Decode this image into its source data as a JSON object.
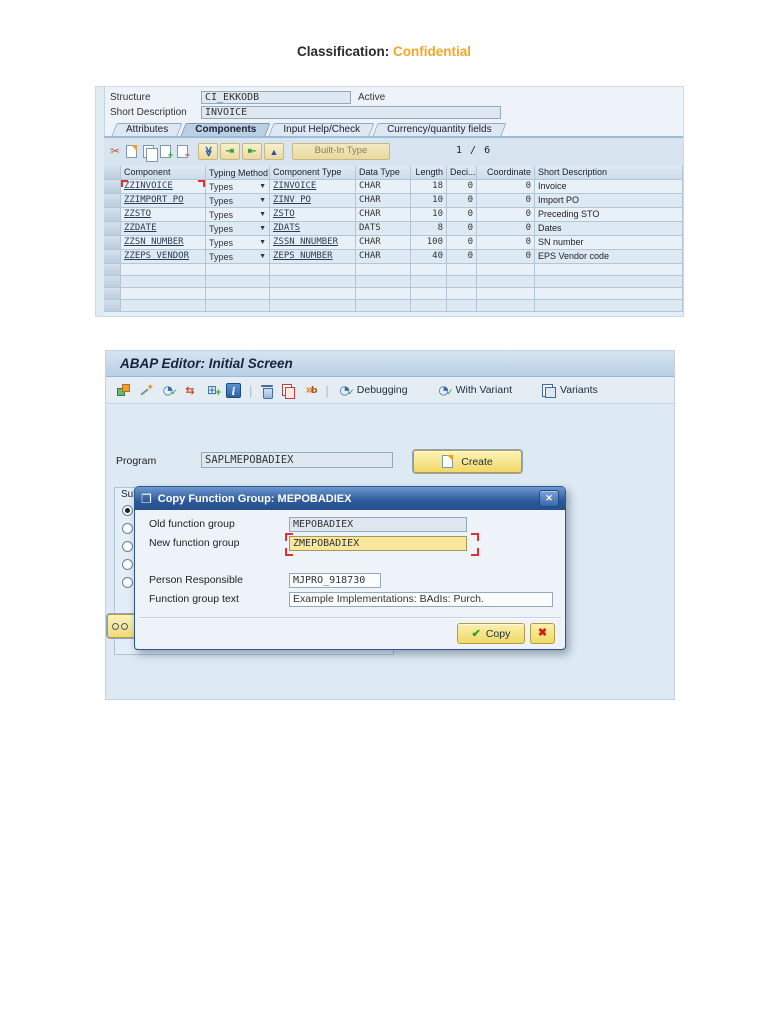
{
  "page": {
    "classification_label": "Classification:",
    "classification_value": "Confidential",
    "accent_orange": "#f5a623"
  },
  "structure_editor": {
    "structure_label": "Structure",
    "structure_value": "CI_EKKODB",
    "status": "Active",
    "short_description_label": "Short Description",
    "short_description_value": "INVOICE",
    "tabs": [
      "Attributes",
      "Components",
      "Input Help/Check",
      "Currency/quantity fields"
    ],
    "active_tab": "Components",
    "toolbar": {
      "builtin_type_label": "Built-In Type",
      "position_indicator": "1 / 6"
    },
    "table": {
      "headers": [
        "Component",
        "Typing Method",
        "Component Type",
        "Data Type",
        "Length",
        "Deci...",
        "Coordinate",
        "Short Description"
      ],
      "rows": [
        {
          "component": "ZZINVOICE",
          "typing_method": "Types",
          "component_type": "ZINVOICE",
          "data_type": "CHAR",
          "length": "18",
          "decimals": "0",
          "coordinate": "0",
          "short_description": "Invoice"
        },
        {
          "component": "ZZIMPORT_PO",
          "typing_method": "Types",
          "component_type": "ZINV_PO",
          "data_type": "CHAR",
          "length": "10",
          "decimals": "0",
          "coordinate": "0",
          "short_description": "Import PO"
        },
        {
          "component": "ZZSTO",
          "typing_method": "Types",
          "component_type": "ZSTO",
          "data_type": "CHAR",
          "length": "10",
          "decimals": "0",
          "coordinate": "0",
          "short_description": "Preceding STO"
        },
        {
          "component": "ZZDATE",
          "typing_method": "Types",
          "component_type": "ZDATS",
          "data_type": "DATS",
          "length": "8",
          "decimals": "0",
          "coordinate": "0",
          "short_description": "Dates"
        },
        {
          "component": "ZZSN_NUMBER",
          "typing_method": "Types",
          "component_type": "ZSSN_NNUMBER",
          "data_type": "CHAR",
          "length": "100",
          "decimals": "0",
          "coordinate": "0",
          "short_description": "SN number"
        },
        {
          "component": "ZZEPS_VENDOR",
          "typing_method": "Types",
          "component_type": "ZEPS_NUMBER",
          "data_type": "CHAR",
          "length": "40",
          "decimals": "0",
          "coordinate": "0",
          "short_description": "EPS Vendor code"
        }
      ],
      "empty_row_count": 4
    }
  },
  "abap_editor": {
    "title": "ABAP Editor: Initial Screen",
    "toolbar": {
      "debugging_label": "Debugging",
      "with_variant_label": "With Variant",
      "variants_label": "Variants"
    },
    "program_label": "Program",
    "program_value": "SAPLMEPOBADIEX",
    "create_label": "Create",
    "subobjects_label": "Sub",
    "dialog": {
      "title": "Copy Function Group: MEPOBADIEX",
      "old_group_label": "Old function group",
      "old_group_value": "MEPOBADIEX",
      "new_group_label": "New function group",
      "new_group_value": "ZMEPOBADIEX",
      "person_label": "Person Responsible",
      "person_value": "MJPRO_918730",
      "text_label": "Function group text",
      "text_value": "Example Implementations: BAdIs: Purch.",
      "copy_label": "Copy",
      "focus_field_bg": "#f8e79c",
      "titlebar_blue": "#2d5a9b"
    }
  }
}
